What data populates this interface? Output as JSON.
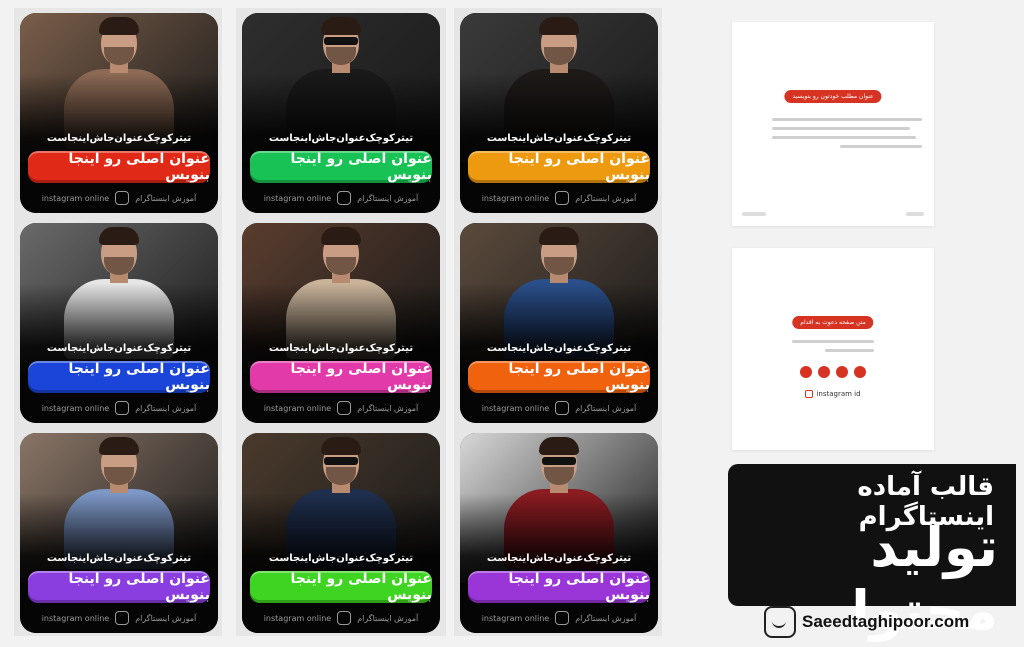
{
  "cards": [
    {
      "subtitle": "تیترکوچک‌عنوان‌جاش‌اینجاست",
      "title": "عنوان اصلی رو اینجا بنویس",
      "pill_color": "#e02a17",
      "photo_color": "#7a5e4a",
      "outfit": "#8c6a55",
      "glasses": false,
      "footer_handle": "instagram online",
      "footer_text": "آموزش اینستاگرام"
    },
    {
      "subtitle": "تیترکوچک‌عنوان‌جاش‌اینجاست",
      "title": "عنوان اصلی رو اینجا بنویس",
      "pill_color": "#18c254",
      "photo_color": "#2e2e2e",
      "outfit": "#1a1a1a",
      "glasses": true,
      "footer_handle": "instagram online",
      "footer_text": "آموزش اینستاگرام"
    },
    {
      "subtitle": "تیترکوچک‌عنوان‌جاش‌اینجاست",
      "title": "عنوان اصلی رو اینجا بنویس",
      "pill_color": "#ee9a10",
      "photo_color": "#3a3a3a",
      "outfit": "#1e1a18",
      "glasses": false,
      "footer_handle": "instagram online",
      "footer_text": "آموزش اینستاگرام"
    },
    {
      "subtitle": "تیترکوچک‌عنوان‌جاش‌اینجاست",
      "title": "عنوان اصلی رو اینجا بنویس",
      "pill_color": "#1b45d8",
      "photo_color": "#6a6a6a",
      "outfit": "#e6e6e6",
      "glasses": false,
      "footer_handle": "instagram online",
      "footer_text": "آموزش اینستاگرام"
    },
    {
      "subtitle": "تیترکوچک‌عنوان‌جاش‌اینجاست",
      "title": "عنوان اصلی رو اینجا بنویس",
      "pill_color": "#e23aa8",
      "photo_color": "#5a3d2e",
      "outfit": "#c9b49a",
      "glasses": false,
      "footer_handle": "instagram online",
      "footer_text": "آموزش اینستاگرام"
    },
    {
      "subtitle": "تیترکوچک‌عنوان‌جاش‌اینجاست",
      "title": "عنوان اصلی رو اینجا بنویس",
      "pill_color": "#f0620e",
      "photo_color": "#5b4a3c",
      "outfit": "#2a4f8a",
      "glasses": false,
      "footer_handle": "instagram online",
      "footer_text": "آموزش اینستاگرام"
    },
    {
      "subtitle": "تیترکوچک‌عنوان‌جاش‌اینجاست",
      "title": "عنوان اصلی رو اینجا بنویس",
      "pill_color": "#8a3ee0",
      "photo_color": "#8a7566",
      "outfit": "#7d97c7",
      "glasses": false,
      "footer_handle": "instagram online",
      "footer_text": "آموزش اینستاگرام"
    },
    {
      "subtitle": "تیترکوچک‌عنوان‌جاش‌اینجاست",
      "title": "عنوان اصلی رو اینجا بنویس",
      "pill_color": "#3fd421",
      "photo_color": "#4a3a2c",
      "outfit": "#1f2f4e",
      "glasses": true,
      "footer_handle": "instagram online",
      "footer_text": "آموزش اینستاگرام"
    },
    {
      "subtitle": "تیترکوچک‌عنوان‌جاش‌اینجاست",
      "title": "عنوان اصلی رو اینجا بنویس",
      "pill_color": "#9a35d8",
      "photo_color": "#d8d8d8",
      "outfit": "#8b1c22",
      "glasses": true,
      "footer_handle": "instagram online",
      "footer_text": "آموزش اینستاگرام"
    }
  ],
  "sheet1": {
    "badge": "عنوان مطلب خودتون رو بنویسید"
  },
  "sheet2": {
    "badge": "متن صفحه دعوت به اقدام",
    "handle": "instagram id"
  },
  "banner": {
    "line1": "قالب آماده اینستاگرام",
    "line2": "تولید محتوا"
  },
  "site": {
    "name": "Saeedtaghipoor.com"
  },
  "accent": "#d73323"
}
